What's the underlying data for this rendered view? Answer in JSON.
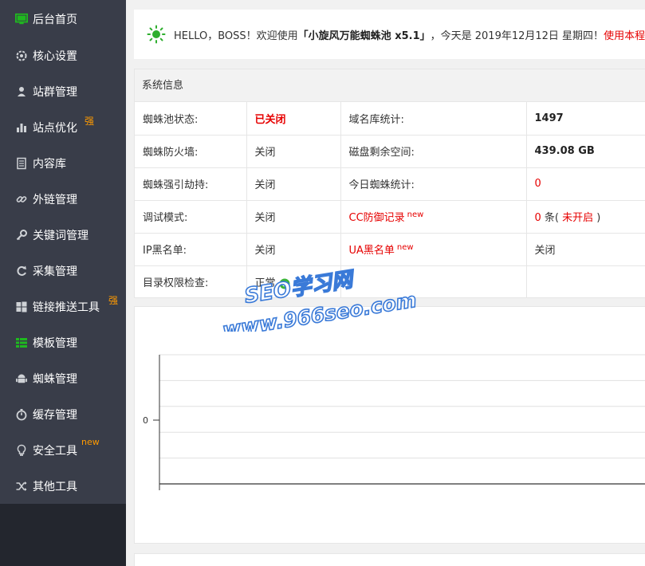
{
  "sidebar": {
    "items": [
      {
        "label": "后台首页",
        "icon": "monitor-icon",
        "badge": ""
      },
      {
        "label": "核心设置",
        "icon": "gear-icon",
        "badge": ""
      },
      {
        "label": "站群管理",
        "icon": "user-icon",
        "badge": ""
      },
      {
        "label": "站点优化",
        "icon": "bar-chart-icon",
        "badge": "强"
      },
      {
        "label": "内容库",
        "icon": "document-icon",
        "badge": ""
      },
      {
        "label": "外链管理",
        "icon": "link-icon",
        "badge": ""
      },
      {
        "label": "关键词管理",
        "icon": "key-icon",
        "badge": ""
      },
      {
        "label": "采集管理",
        "icon": "refresh-icon",
        "badge": ""
      },
      {
        "label": "链接推送工具",
        "icon": "windows-icon",
        "badge": "强"
      },
      {
        "label": "模板管理",
        "icon": "list-icon",
        "badge": ""
      },
      {
        "label": "蜘蛛管理",
        "icon": "android-icon",
        "badge": ""
      },
      {
        "label": "缓存管理",
        "icon": "timer-icon",
        "badge": ""
      },
      {
        "label": "安全工具",
        "icon": "bulb-icon",
        "badge": "new"
      },
      {
        "label": "其他工具",
        "icon": "shuffle-icon",
        "badge": ""
      }
    ]
  },
  "welcome": {
    "prefix": "HELLO，BOSS！欢迎使用",
    "product": "「小旋风万能蜘蛛池 x5.1」",
    "date_text": "，今天是 2019年12月12日 星期四！",
    "link": "使用本程序"
  },
  "system_info": {
    "title": "系统信息",
    "rows": [
      {
        "l1": "蜘蛛池状态:",
        "v1": "已关闭",
        "l2": "域名库统计:",
        "v2": "1497"
      },
      {
        "l1": "蜘蛛防火墙:",
        "v1": "关闭",
        "l2": "磁盘剩余空间:",
        "v2": "439.08 GB"
      },
      {
        "l1": "蜘蛛强引劫持:",
        "v1": "关闭",
        "l2": "今日蜘蛛统计:",
        "v2": "0"
      },
      {
        "l1": "调试模式:",
        "v1": "关闭",
        "l2": "CC防御记录",
        "v2_num": "0",
        "v2_unit": " 条(",
        "v2_state": " 未开启 ",
        "v2_close": ")"
      },
      {
        "l1": "IP黑名单:",
        "v1": "关闭",
        "l2": "UA黑名单",
        "v2": "关闭"
      },
      {
        "l1": "目录权限检查:",
        "v1": "正常",
        "l2": "",
        "v2": ""
      }
    ],
    "new_tag": "new"
  },
  "chart_data": {
    "type": "line",
    "title": "",
    "xlabel": "",
    "ylabel": "",
    "y_ticks": [
      "0"
    ],
    "series": []
  },
  "watermark": {
    "line1": "SEO学习网",
    "line2": "www.966seo.com"
  },
  "colors": {
    "sidebar_bg": "#393d49",
    "sidebar_bottom": "#23262e",
    "accent_green": "#009688",
    "badge_orange": "#ff9a00",
    "alert_red": "#e60000"
  }
}
